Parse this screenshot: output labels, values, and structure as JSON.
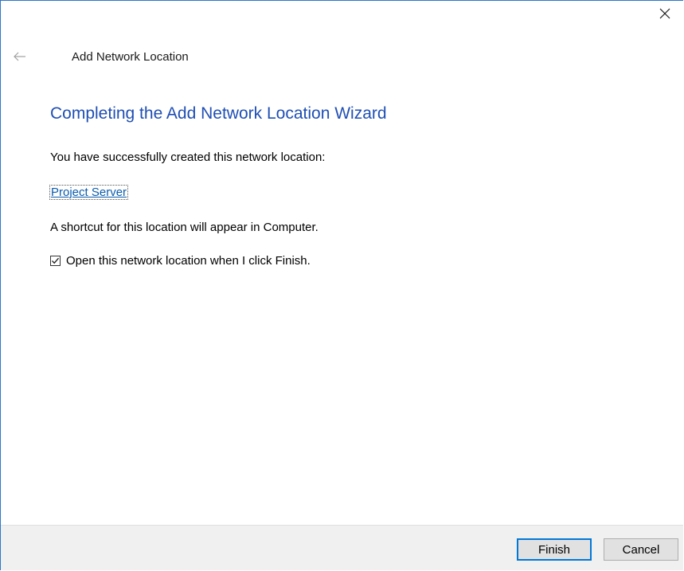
{
  "window": {
    "title": "Add Network Location",
    "close_icon": "close-icon",
    "back_icon": "back-arrow-icon"
  },
  "content": {
    "heading": "Completing the Add Network Location Wizard",
    "success_message": "You have successfully created this network location:",
    "location_name": "Project Server",
    "shortcut_message": "A shortcut for this location will appear in Computer.",
    "open_checkbox": {
      "label": "Open this network location when I click Finish.",
      "checked": true
    }
  },
  "footer": {
    "finish_label": "Finish",
    "cancel_label": "Cancel"
  },
  "colors": {
    "heading": "#1f4fb4",
    "link": "#0b5cad",
    "accent_border": "#0078d7",
    "footer_bg": "#f0f0f0"
  }
}
